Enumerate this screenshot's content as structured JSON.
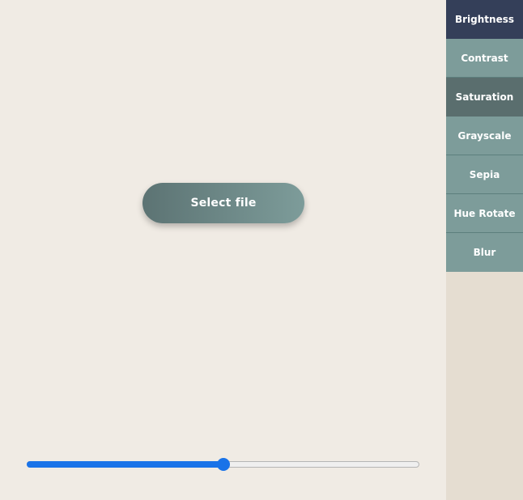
{
  "main": {
    "select_file_label": "Select file"
  },
  "slider": {
    "value": 50,
    "min": 0,
    "max": 100,
    "color": "#1a73e8"
  },
  "sidebar": {
    "items": [
      {
        "label": "Brightness",
        "state": "active"
      },
      {
        "label": "Contrast",
        "state": "normal"
      },
      {
        "label": "Saturation",
        "state": "hover"
      },
      {
        "label": "Grayscale",
        "state": "normal"
      },
      {
        "label": "Sepia",
        "state": "normal"
      },
      {
        "label": "Hue Rotate",
        "state": "normal"
      },
      {
        "label": "Blur",
        "state": "normal"
      }
    ]
  },
  "colors": {
    "background": "#f0ebe4",
    "sidebar_bg": "#e5ddd1",
    "sidebar_item": "#7d9c9a",
    "sidebar_active": "#343f59",
    "sidebar_hover": "#5a6e6e",
    "button_gradient_start": "#5c7373",
    "button_gradient_end": "#7d9c9a"
  }
}
